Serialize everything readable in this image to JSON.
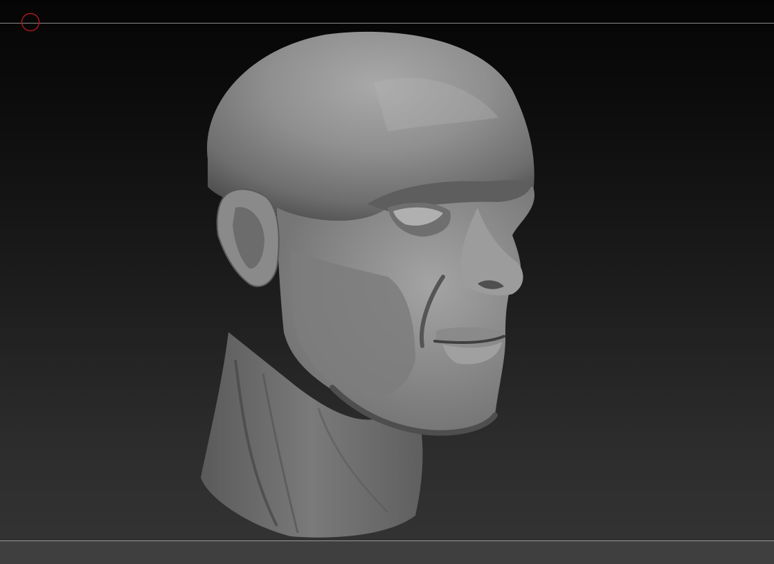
{
  "app": {
    "name": "",
    "view": "sculpt viewport"
  },
  "viewport": {
    "background_top": "#050505",
    "background_bottom": "#343434",
    "rule_color": "#8a8a8a"
  },
  "cursor": {
    "icon": "brush-circle-icon",
    "color": "#b3161b"
  },
  "model": {
    "icon": "sculpted-head-icon",
    "material_color": "#8c8c8c"
  }
}
